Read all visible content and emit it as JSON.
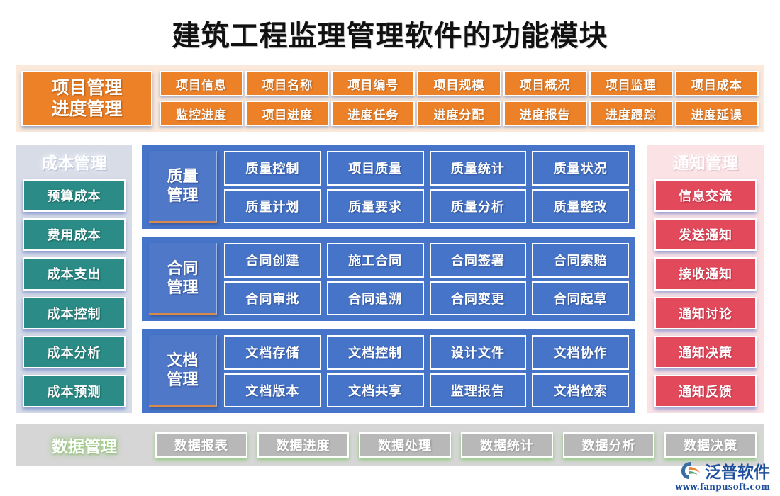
{
  "title": "建筑工程监理管理软件的功能模块",
  "colors": {
    "orange": "#ed8128",
    "orange_bg": "#fbeadb",
    "teal": "#2b8b86",
    "teal_bg": "#d7dce7",
    "blue": "#4674c8",
    "red": "#e24a5c",
    "pink_bg": "#fbe2e4",
    "gray": "#b8b8b8",
    "gray_bg": "#d6d6d6",
    "logo_blue": "#1f4e9c"
  },
  "orange_band": {
    "label_line1": "项目管理",
    "label_line2": "进度管理",
    "rows": [
      {
        "name": "项目管理",
        "items": [
          "项目信息",
          "项目名称",
          "项目编号",
          "项目规模",
          "项目概况",
          "项目监理",
          "项目成本"
        ]
      },
      {
        "name": "进度管理",
        "items": [
          "监控进度",
          "项目进度",
          "进度任务",
          "进度分配",
          "进度报告",
          "进度跟踪",
          "进度延误"
        ]
      }
    ]
  },
  "cost_column": {
    "head": "成本管理",
    "items": [
      "预算成本",
      "费用成本",
      "成本支出",
      "成本控制",
      "成本分析",
      "成本预测"
    ]
  },
  "center_panels": [
    {
      "head_line1": "质量",
      "head_line2": "管理",
      "row1": [
        "质量控制",
        "项目质量",
        "质量统计",
        "质量状况"
      ],
      "row2": [
        "质量计划",
        "质量要求",
        "质量分析",
        "质量整改"
      ]
    },
    {
      "head_line1": "合同",
      "head_line2": "管理",
      "row1": [
        "合同创建",
        "施工合同",
        "合同签署",
        "合同索赔"
      ],
      "row2": [
        "合同审批",
        "合同追溯",
        "合同变更",
        "合同起草"
      ]
    },
    {
      "head_line1": "文档",
      "head_line2": "管理",
      "row1": [
        "文档存储",
        "文档控制",
        "设计文件",
        "文档协作"
      ],
      "row2": [
        "文档版本",
        "文档共享",
        "监理报告",
        "文档检索"
      ]
    }
  ],
  "notify_column": {
    "head": "通知管理",
    "items": [
      "信息交流",
      "发送通知",
      "接收通知",
      "通知讨论",
      "通知决策",
      "通知反馈"
    ]
  },
  "data_band": {
    "head": "数据管理",
    "items": [
      "数据报表",
      "数据进度",
      "数据处理",
      "数据统计",
      "数据分析",
      "数据决策"
    ]
  },
  "logo": {
    "name": "泛普软件",
    "url": "www.fanpusoft.com"
  }
}
